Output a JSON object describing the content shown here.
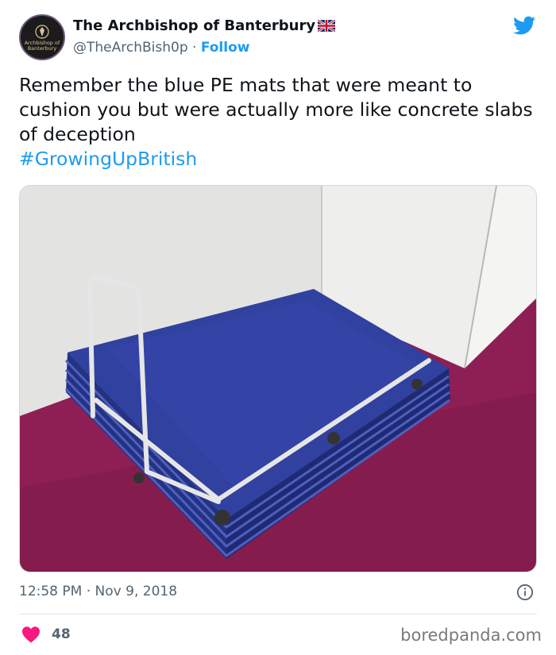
{
  "tweet": {
    "display_name": "The Archbishop of Banterbury",
    "handle": "@TheArchBish0p",
    "separator": "·",
    "follow_label": "Follow",
    "avatar_text": [
      "Archbishop of",
      "Banterbury"
    ],
    "body": "Remember the blue PE mats that were meant to cushion you but were actually more like concrete slabs of deception",
    "hashtag": "#GrowingUpBritish",
    "time": "12:58 PM",
    "date": "Nov 9, 2018",
    "likes": "48"
  },
  "watermark": "boredpanda.com",
  "colors": {
    "accent": "#1d9bf0",
    "like": "#f91880",
    "secondary_text": "#536471",
    "mat_blue": "#2f3f9a",
    "floor_magenta": "#8e1f54"
  },
  "icons": [
    "twitter-bird-icon",
    "uk-flag-icon",
    "info-icon",
    "heart-icon"
  ],
  "media": {
    "description_note": "photo of stacked blue gym mats on a trolley"
  }
}
